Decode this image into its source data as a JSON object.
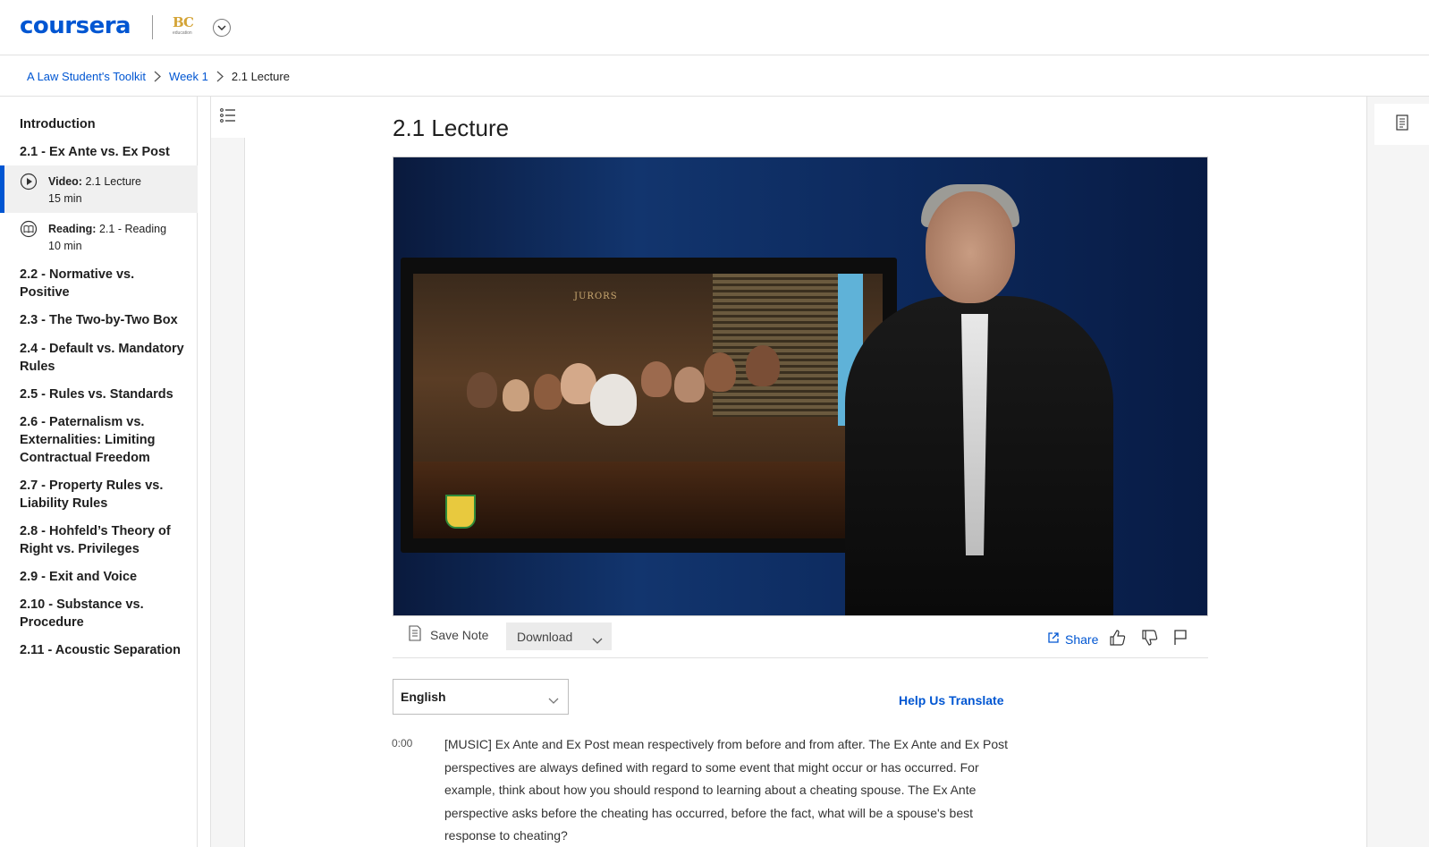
{
  "header": {
    "logo_text": "coursera",
    "partner_mark": "BC",
    "partner_sub": "education"
  },
  "breadcrumb": {
    "course": "A Law Student's Toolkit",
    "week": "Week 1",
    "current": "2.1 Lecture"
  },
  "sidebar": {
    "sections": [
      "Introduction",
      "2.1 - Ex Ante vs. Ex Post",
      "2.2 - Normative vs. Positive",
      "2.3 - The Two-by-Two Box",
      "2.4 - Default vs. Mandatory Rules",
      "2.5 - Rules vs. Standards",
      "2.6 - Paternalism vs. Externalities: Limiting Contractual Freedom",
      "2.7 - Property Rules vs. Liability Rules",
      "2.8 - Hohfeld’s Theory of Right vs. Privileges",
      "2.9 - Exit and Voice",
      "2.10 - Substance vs. Procedure",
      "2.11 - Acoustic Separation"
    ],
    "items": [
      {
        "type": "Video:",
        "title": "2.1 Lecture",
        "duration": "15 min"
      },
      {
        "type": "Reading:",
        "title": "2.1 - Reading",
        "duration": "10 min"
      }
    ]
  },
  "main": {
    "title": "2.1 Lecture",
    "video_sign": "JURORS",
    "save_note": "Save Note",
    "download": "Download",
    "share": "Share",
    "language": "English",
    "help_translate": "Help Us Translate",
    "transcript_time": "0:00",
    "transcript_text": "[MUSIC] Ex Ante and Ex Post mean respectively from before and from after. The Ex Ante and Ex Post perspectives are always defined with regard to some event that might occur or has occurred. For example, think about how you should respond to learning about a cheating spouse. The Ex Ante perspective asks before the cheating has occurred, before the fact, what will be a spouse's best response to cheating?"
  },
  "colors": {
    "brand": "#0056d2",
    "active_bg": "#f0f0f0"
  }
}
